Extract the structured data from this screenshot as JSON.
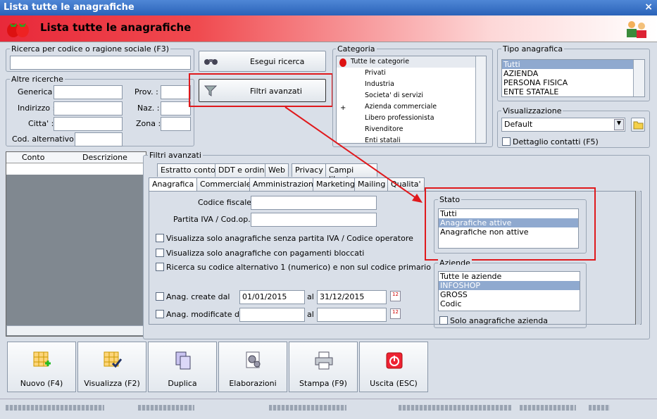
{
  "window": {
    "title": "Lista tutte le anagrafiche",
    "close": "×"
  },
  "header": {
    "title": "Lista tutte le anagrafiche"
  },
  "search": {
    "group": "Ricerca per codice o ragione sociale (F3)",
    "value": "",
    "exec_button": "Esegui ricerca",
    "filters_button": "Filtri avanzati"
  },
  "altre": {
    "group": "Altre ricerche",
    "generica": "Generica :",
    "indirizzo": "Indirizzo :",
    "citta": "Citta' :",
    "cod_alt": "Cod. alternativo :",
    "prov": "Prov. :",
    "naz": "Naz. :",
    "zona": "Zona :"
  },
  "categoria": {
    "group": "Categoria",
    "items": [
      "Tutte le categorie",
      "Privati",
      "Industria",
      "Societa' di servizi",
      "Azienda commerciale",
      "Libero professionista",
      "Rivenditore",
      "Enti statali"
    ],
    "expander": "+"
  },
  "tipo": {
    "group": "Tipo anagrafica",
    "items": [
      "Tutti",
      "AZIENDA",
      "PERSONA FISICA",
      "ENTE STATALE"
    ]
  },
  "visualizzazione": {
    "group": "Visualizzazione",
    "value": "Default",
    "dettaglio": "Dettaglio contatti (F5)"
  },
  "grid": {
    "columns": [
      "Conto",
      "Descrizione conto"
    ]
  },
  "filtri": {
    "group": "Filtri avanzati",
    "tabs_row1": [
      "Estratto conto",
      "DDT e ordini",
      "Web",
      "Privacy",
      "Campi liberi"
    ],
    "tabs_row2": [
      "Anagrafica",
      "Commerciale",
      "Amministrazione",
      "Marketing",
      "Mailing",
      "Qualita'"
    ],
    "codice_fiscale": "Codice fiscale",
    "partita_iva": "Partita IVA / Cod.op.",
    "chk1": "Visualizza solo anagrafiche senza partita IVA / Codice operatore",
    "chk2": "Visualizza solo anagrafiche con pagamenti bloccati",
    "chk3": "Ricerca su codice alternativo 1 (numerico)  e non sul codice primario",
    "create": "Anag. create dal",
    "create_from": "01/01/2015",
    "al": "al",
    "create_to": "31/12/2015",
    "modificate": "Anag. modificate dal"
  },
  "stato": {
    "group": "Stato",
    "items": [
      "Tutti",
      "Anagrafiche attive",
      "Anagrafiche non attive"
    ]
  },
  "aziende": {
    "group": "Aziende",
    "items": [
      "Tutte le aziende",
      "INFOSHOP",
      "GROSS",
      "Codic"
    ],
    "solo": "Solo anagrafiche azienda"
  },
  "buttons": [
    "Nuovo (F4)",
    "Visualizza (F2)",
    "Duplica",
    "Elaborazioni",
    "Stampa (F9)",
    "Uscita (ESC)"
  ],
  "colors": {
    "highlight": "#e0191c",
    "selection": "#8fa9cf"
  }
}
